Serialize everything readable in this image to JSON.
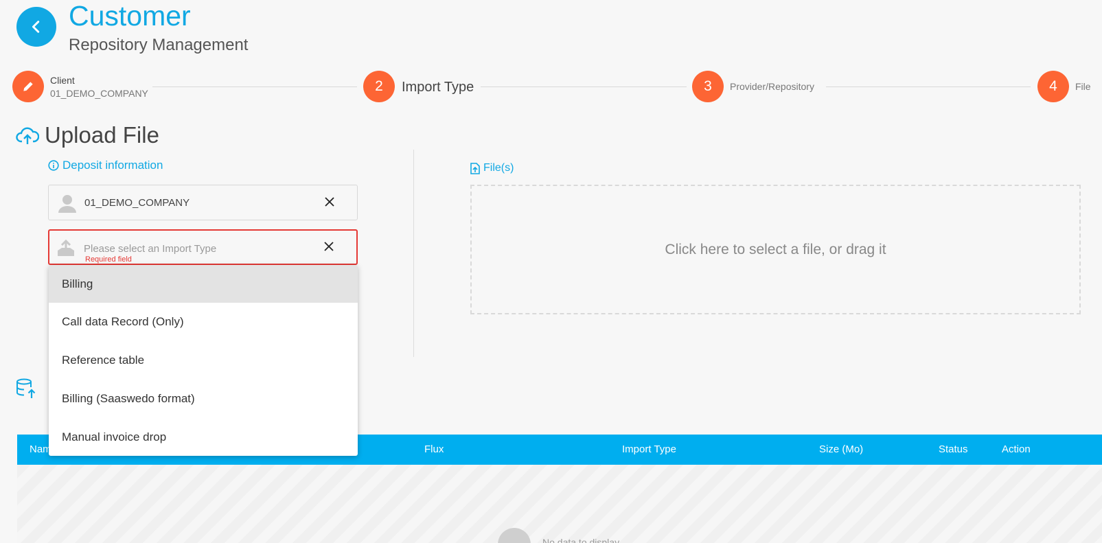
{
  "header": {
    "title": "Customer",
    "subtitle": "Repository Management"
  },
  "stepper": {
    "step1": {
      "label": "Client",
      "sublabel": "01_DEMO_COMPANY"
    },
    "step2": {
      "number": "2",
      "label": "Import Type"
    },
    "step3": {
      "number": "3",
      "label": "Provider/Repository"
    },
    "step4": {
      "number": "4",
      "label": "File"
    }
  },
  "upload": {
    "title": "Upload File",
    "deposit_link": "Deposit information",
    "client_value": "01_DEMO_COMPANY",
    "import_type_placeholder": "Please select an Import Type",
    "required_text": "Required field",
    "files_link": "File(s)",
    "dropzone_text": "Click here to select a file, or drag it"
  },
  "dropdown": {
    "options": [
      "Billing",
      "Call data Record (Only)",
      "Reference table",
      "Billing (Saaswedo format)",
      "Manual invoice drop"
    ]
  },
  "table": {
    "columns": [
      "Nam",
      "Flux",
      "Import Type",
      "Size (Mo)",
      "Status",
      "Action"
    ],
    "empty_text": "No data to display"
  },
  "colors": {
    "accent": "#11a8e3",
    "step": "#fd6534",
    "table_header": "#00aeef",
    "error": "#e53935"
  }
}
